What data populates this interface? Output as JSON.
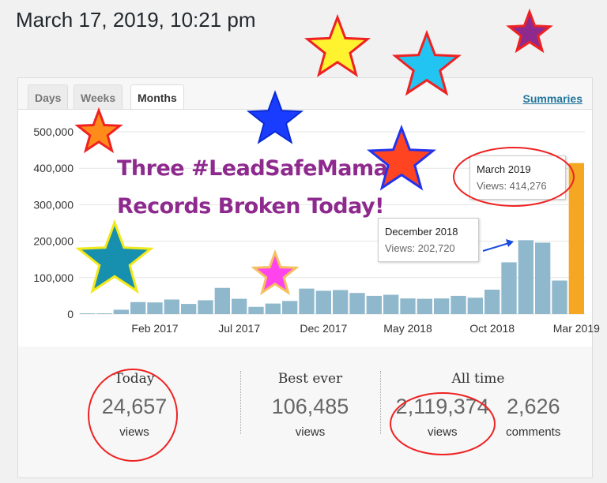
{
  "header": {
    "datetime": "March 17, 2019, 10:21 pm"
  },
  "tabs": [
    {
      "label": "Days",
      "active": false
    },
    {
      "label": "Weeks",
      "active": false
    },
    {
      "label": "Months",
      "active": true
    }
  ],
  "summaries_link": "Summaries",
  "headline": {
    "line1": "Three #LeadSafeMama",
    "line2": "Records Broken Today!",
    "color": "#8e2a8e"
  },
  "tooltips": {
    "march": {
      "title": "March 2019",
      "views": "Views: 414,276"
    },
    "december": {
      "title": "December 2018",
      "views": "Views: 202,720"
    }
  },
  "stats": {
    "today": {
      "heading": "Today",
      "value": "24,657",
      "unit": "views"
    },
    "best": {
      "heading": "Best ever",
      "value": "106,485",
      "unit": "views"
    },
    "alltime": {
      "heading": "All time",
      "views": "2,119,374",
      "views_unit": "views",
      "comments": "2,626",
      "comments_unit": "comments"
    }
  },
  "colors": {
    "bar": "#8fb8cc",
    "highlight": "#f5a623",
    "annotation": "#ee2222",
    "arrow": "#1a4be0"
  },
  "chart_data": {
    "type": "bar",
    "categories": [
      "Oct 2016",
      "Nov 2016",
      "Dec 2016",
      "Jan 2017",
      "Feb 2017",
      "Mar 2017",
      "Apr 2017",
      "May 2017",
      "Jun 2017",
      "Jul 2017",
      "Aug 2017",
      "Sep 2017",
      "Oct 2017",
      "Nov 2017",
      "Dec 2017",
      "Jan 2018",
      "Feb 2018",
      "Mar 2018",
      "Apr 2018",
      "May 2018",
      "Jun 2018",
      "Jul 2018",
      "Aug 2018",
      "Sep 2018",
      "Oct 2018",
      "Nov 2018",
      "Dec 2018",
      "Jan 2019",
      "Feb 2019",
      "Mar 2019"
    ],
    "values": [
      2000,
      2000,
      12000,
      33000,
      32000,
      40000,
      28000,
      38000,
      72000,
      42000,
      20000,
      29000,
      36000,
      70000,
      64000,
      66000,
      58000,
      50000,
      53000,
      43000,
      42000,
      43000,
      50000,
      45000,
      67000,
      142000,
      202720,
      196000,
      92000,
      414276
    ],
    "highlighted": "Mar 2019",
    "x_tick_labels": [
      "Feb 2017",
      "Jul 2017",
      "Dec 2017",
      "May 2018",
      "Oct 2018",
      "Mar 2019"
    ],
    "y_tick_labels": [
      "0",
      "100,000",
      "200,000",
      "300,000",
      "400,000",
      "500,000"
    ],
    "ylim": [
      0,
      500000
    ],
    "grid": true
  }
}
